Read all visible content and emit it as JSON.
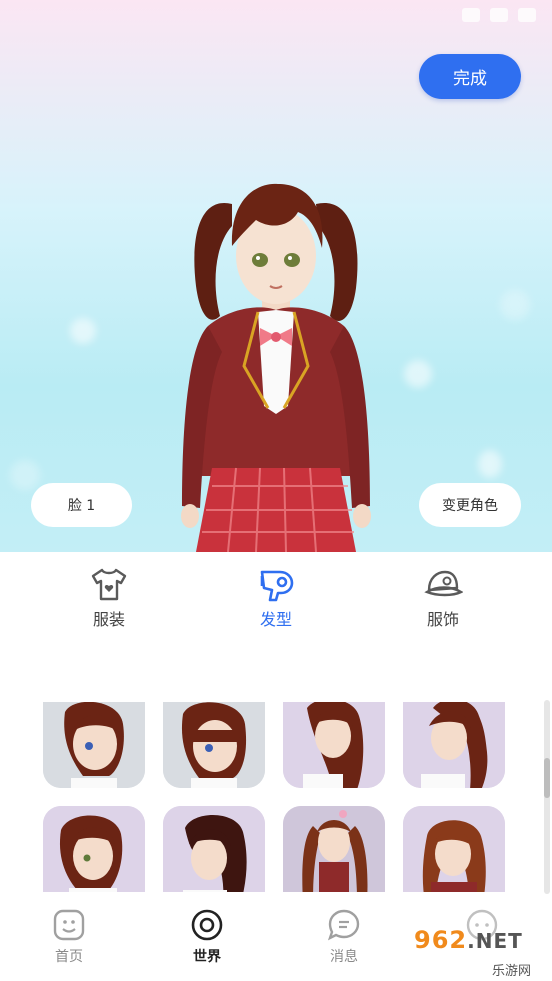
{
  "preview": {
    "done_label": "完成",
    "face_label": "脸 1",
    "change_role_label": "变更角色"
  },
  "categories": [
    {
      "label": "服装",
      "icon": "shirt-icon",
      "active": false
    },
    {
      "label": "发型",
      "icon": "hair-dryer-icon",
      "active": true
    },
    {
      "label": "服饰",
      "icon": "cap-icon",
      "active": false
    }
  ],
  "nav": [
    {
      "label": "首页",
      "icon": "home-icon",
      "active": false
    },
    {
      "label": "世界",
      "icon": "world-icon",
      "active": true
    },
    {
      "label": "消息",
      "icon": "message-icon",
      "active": false
    }
  ],
  "watermark": {
    "logo": "962",
    "net": ".NET",
    "sub": "乐游网"
  },
  "colors": {
    "accent": "#2f6ff0",
    "hair": "#6b2414",
    "blazer": "#8e2a2a"
  }
}
